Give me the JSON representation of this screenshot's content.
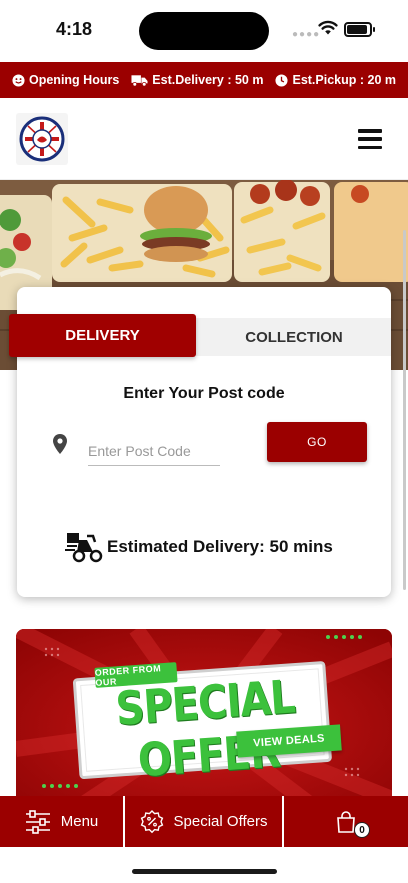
{
  "status_bar": {
    "time": "4:18",
    "battery_level": 0.85
  },
  "info_bar": {
    "opening_hours": "Opening Hours",
    "delivery": "Est.Delivery : 50 m",
    "pickup": "Est.Pickup : 20 m"
  },
  "header": {
    "logo_icon": "restaurant-logo",
    "menu_icon": "hamburger-icon"
  },
  "order_card": {
    "tabs": [
      "DELIVERY",
      "COLLECTION"
    ],
    "active_tab": "DELIVERY",
    "postcode_title": "Enter Your Post code",
    "postcode_placeholder": "Enter Post Code",
    "postcode_value": "",
    "go_label": "GO",
    "estimated_delivery": "Estimated Delivery: 50 mins"
  },
  "promo": {
    "tagline": "ORDER FROM OUR",
    "headline": "SPECIAL OFFER",
    "cta": "VIEW DEALS"
  },
  "bottom_nav": {
    "menu_label": "Menu",
    "offers_label": "Special Offers",
    "cart_count": "0"
  },
  "colors": {
    "brand_red": "#9b0000",
    "offer_green": "#3cc13c"
  }
}
